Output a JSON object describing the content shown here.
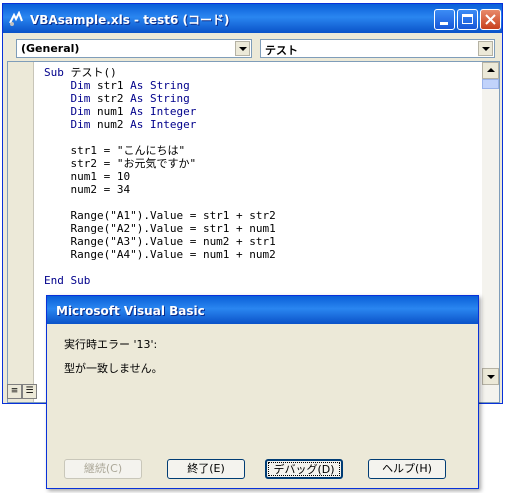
{
  "window": {
    "title": "VBAsample.xls - test6 (コード)",
    "icon": "vba-project-icon",
    "controls": {
      "minimize": "minimize-icon",
      "maximize": "maximize-icon",
      "close": "close-icon"
    }
  },
  "combos": {
    "object": "(General)",
    "procedure": "テスト"
  },
  "code_lines": [
    "Sub テスト()",
    "    Dim str1 As String",
    "    Dim str2 As String",
    "    Dim num1 As Integer",
    "    Dim num2 As Integer",
    "",
    "    str1 = \"こんにちは\"",
    "    str2 = \"お元気ですか\"",
    "    num1 = 10",
    "    num2 = 34",
    "",
    "    Range(\"A1\").Value = str1 + str2",
    "    Range(\"A2\").Value = str1 + num1",
    "    Range(\"A3\").Value = num2 + str1",
    "    Range(\"A4\").Value = num1 + num2",
    "",
    "End Sub"
  ],
  "colors": {
    "keyword": "#00008b",
    "titlebar": "#0a5fd8",
    "face": "#ece9d8"
  },
  "dialog": {
    "title": "Microsoft Visual Basic",
    "line1": "実行時エラー '13':",
    "line2": "型が一致しません。",
    "buttons": {
      "continue": "継続(C)",
      "end": "終了(E)",
      "debug": "デバッグ(D)",
      "help": "ヘルプ(H)"
    }
  }
}
